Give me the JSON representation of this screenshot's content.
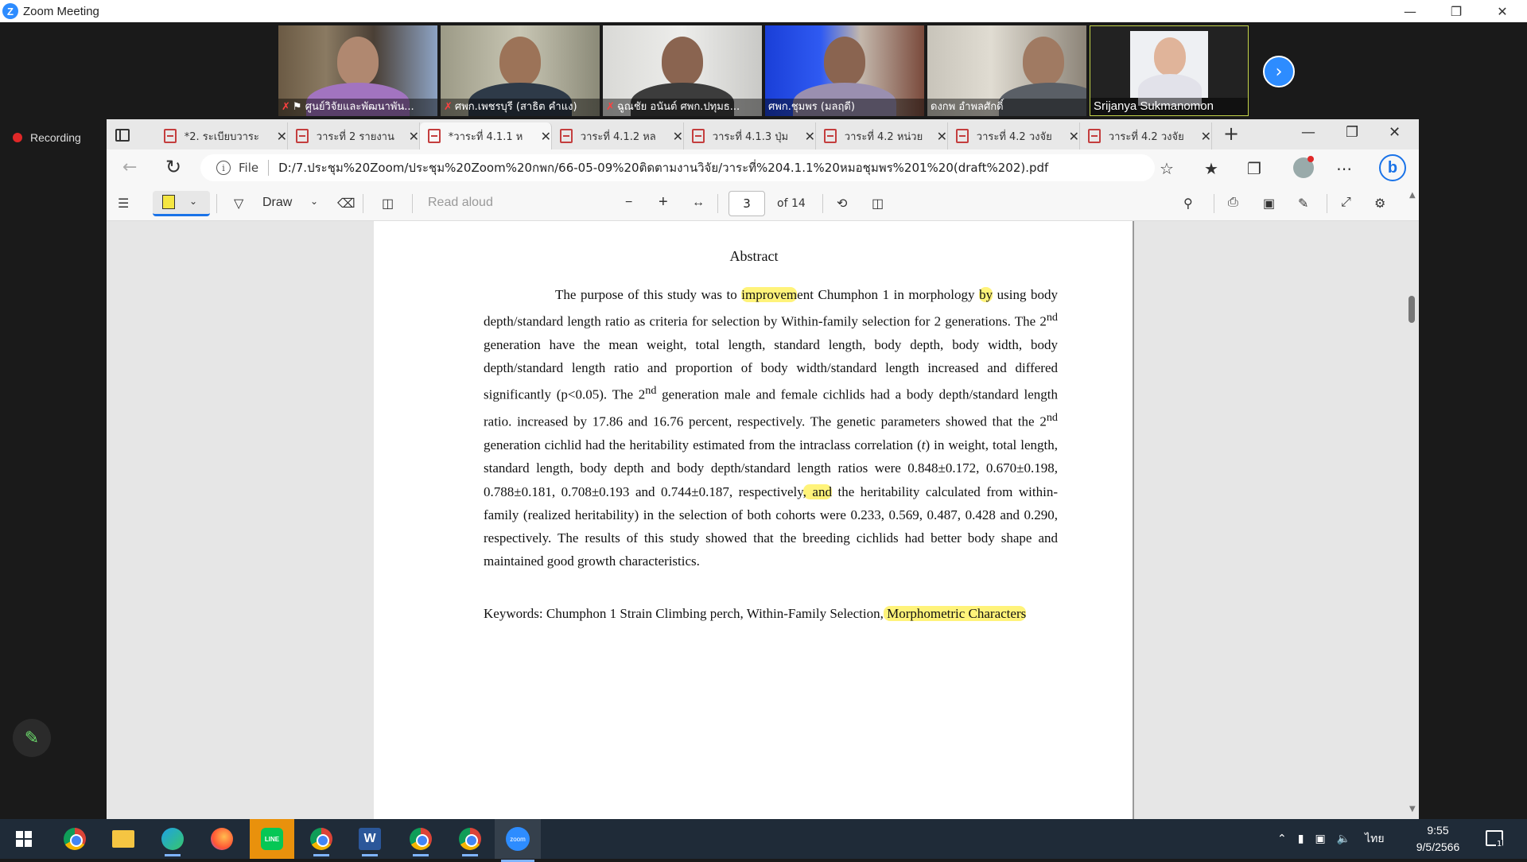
{
  "zoom_window": {
    "title": "Zoom Meeting",
    "logo_letter": "Z",
    "recording_label": "Recording"
  },
  "participants": [
    {
      "name": "ศูนย์วิจัยและพัฒนาพัน...",
      "muted": true,
      "pinned": true,
      "icon": "mic-off-icon"
    },
    {
      "name": "ศพก.เพชรบุรี (สาธิต คำแง)",
      "muted": true
    },
    {
      "name": "ฉูณชัย อนันต์ ศพก.ปทุมธ...",
      "muted": true
    },
    {
      "name": "ศพก.ชุมพร (มลฤดี)",
      "muted": false
    },
    {
      "name": "ดงกพ อำพลศักดิ์",
      "muted": false
    },
    {
      "name": "Srijanya Sukmanomon",
      "muted": false
    }
  ],
  "browser": {
    "tabs": [
      {
        "label": "*2. ระเบียบวาระ"
      },
      {
        "label": "วาระที่ 2 รายงาน"
      },
      {
        "label": "*วาระที่ 4.1.1 ห"
      },
      {
        "label": "วาระที่ 4.1.2 หล"
      },
      {
        "label": "วาระที่ 4.1.3 ปุ่ม"
      },
      {
        "label": "วาระที่ 4.2 หน่วย"
      },
      {
        "label": "วาระที่ 4.2 วงจัย"
      },
      {
        "label": "วาระที่ 4.2 วงจัย"
      }
    ],
    "active_tab_index": 2,
    "file_label": "File",
    "url": "D:/7.ประชุม%20Zoom/ประชุม%20Zoom%20กพก/66-05-09%20ติดตามงานวิจัย/วาระที่%204.1.1%20หมอชุมพร%201%20(draft%202).pdf"
  },
  "pdf_toolbar": {
    "draw_label": "Draw",
    "read_aloud_label": "Read aloud",
    "page_number": "3",
    "page_total": "of 14"
  },
  "document": {
    "title": "Abstract",
    "body": {
      "p1": "The purpose of this study was to ",
      "hl1": "improvem",
      "p2": "ent Chumphon 1 in morphology ",
      "hl2": "by",
      "p3": " using body depth/standard length ratio as criteria for selection by Within-family selection for 2 generations. The 2",
      "sup1": "nd",
      "p4": " generation have the mean weight, total length, standard length, body depth, body width, body depth/standard length ratio and proportion of body width/standard length increased and differed significantly (p<0.05). The 2",
      "sup2": "nd",
      "p5": " generation male and female cichlids had a body depth/standard length ratio. increased by 17.86 and 16.76 percent, respectively. The genetic parameters showed that the 2",
      "sup3": "nd",
      "p6": " generation cichlid had the heritability estimated from the intraclass correlation (",
      "t": "t",
      "p7": ") in weight, total length, standard length, body depth and body depth/standard length ratios were 0.848±0.172, 0.670±0.198, 0.788±0.181, 0.708±0.193 and 0.744±0.187, respectively",
      "hl3": ", and",
      "p8": " the heritability calculated from within-family (realized heritability) in the selection of both cohorts were 0.233, 0.569, 0.487, 0.428 and 0.290, respectively. The results of this study showed that the breeding cichlids had better body shape and maintained good growth characteristics."
    },
    "keywords_label": "Keywords:",
    "keywords_text": " Chumphon 1 Strain Climbing perch, Within-Family Selection,",
    "keywords_highlight": " Morphometric Characters"
  },
  "taskbar": {
    "language": "ไทย",
    "time": "9:55",
    "date": "9/5/2566",
    "line_label": "LINE",
    "word_label": "W",
    "zoom_label": "zoom",
    "notification_count": "1"
  },
  "colors": {
    "zoom_blue": "#2D8CFF",
    "highlight_yellow": "#fff37a",
    "taskbar_bg": "#1f2b38"
  }
}
